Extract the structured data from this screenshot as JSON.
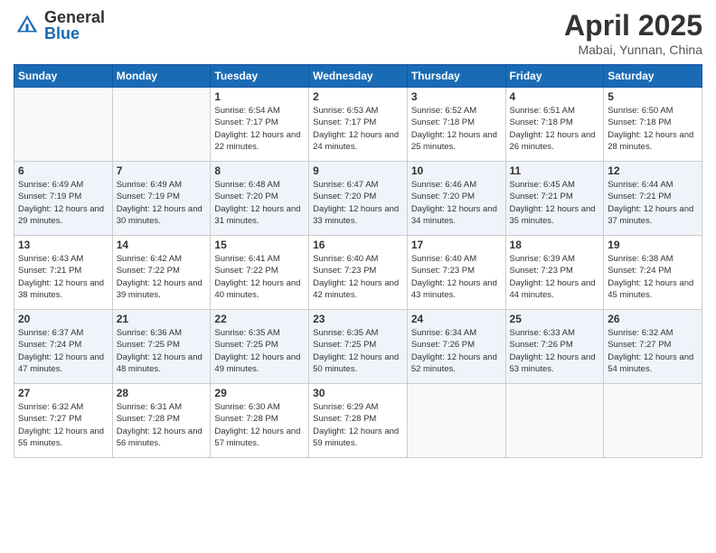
{
  "header": {
    "logo_general": "General",
    "logo_blue": "Blue",
    "title": "April 2025",
    "location": "Mabai, Yunnan, China"
  },
  "weekdays": [
    "Sunday",
    "Monday",
    "Tuesday",
    "Wednesday",
    "Thursday",
    "Friday",
    "Saturday"
  ],
  "weeks": [
    [
      {
        "day": "",
        "sunrise": "",
        "sunset": "",
        "daylight": ""
      },
      {
        "day": "",
        "sunrise": "",
        "sunset": "",
        "daylight": ""
      },
      {
        "day": "1",
        "sunrise": "Sunrise: 6:54 AM",
        "sunset": "Sunset: 7:17 PM",
        "daylight": "Daylight: 12 hours and 22 minutes."
      },
      {
        "day": "2",
        "sunrise": "Sunrise: 6:53 AM",
        "sunset": "Sunset: 7:17 PM",
        "daylight": "Daylight: 12 hours and 24 minutes."
      },
      {
        "day": "3",
        "sunrise": "Sunrise: 6:52 AM",
        "sunset": "Sunset: 7:18 PM",
        "daylight": "Daylight: 12 hours and 25 minutes."
      },
      {
        "day": "4",
        "sunrise": "Sunrise: 6:51 AM",
        "sunset": "Sunset: 7:18 PM",
        "daylight": "Daylight: 12 hours and 26 minutes."
      },
      {
        "day": "5",
        "sunrise": "Sunrise: 6:50 AM",
        "sunset": "Sunset: 7:18 PM",
        "daylight": "Daylight: 12 hours and 28 minutes."
      }
    ],
    [
      {
        "day": "6",
        "sunrise": "Sunrise: 6:49 AM",
        "sunset": "Sunset: 7:19 PM",
        "daylight": "Daylight: 12 hours and 29 minutes."
      },
      {
        "day": "7",
        "sunrise": "Sunrise: 6:49 AM",
        "sunset": "Sunset: 7:19 PM",
        "daylight": "Daylight: 12 hours and 30 minutes."
      },
      {
        "day": "8",
        "sunrise": "Sunrise: 6:48 AM",
        "sunset": "Sunset: 7:20 PM",
        "daylight": "Daylight: 12 hours and 31 minutes."
      },
      {
        "day": "9",
        "sunrise": "Sunrise: 6:47 AM",
        "sunset": "Sunset: 7:20 PM",
        "daylight": "Daylight: 12 hours and 33 minutes."
      },
      {
        "day": "10",
        "sunrise": "Sunrise: 6:46 AM",
        "sunset": "Sunset: 7:20 PM",
        "daylight": "Daylight: 12 hours and 34 minutes."
      },
      {
        "day": "11",
        "sunrise": "Sunrise: 6:45 AM",
        "sunset": "Sunset: 7:21 PM",
        "daylight": "Daylight: 12 hours and 35 minutes."
      },
      {
        "day": "12",
        "sunrise": "Sunrise: 6:44 AM",
        "sunset": "Sunset: 7:21 PM",
        "daylight": "Daylight: 12 hours and 37 minutes."
      }
    ],
    [
      {
        "day": "13",
        "sunrise": "Sunrise: 6:43 AM",
        "sunset": "Sunset: 7:21 PM",
        "daylight": "Daylight: 12 hours and 38 minutes."
      },
      {
        "day": "14",
        "sunrise": "Sunrise: 6:42 AM",
        "sunset": "Sunset: 7:22 PM",
        "daylight": "Daylight: 12 hours and 39 minutes."
      },
      {
        "day": "15",
        "sunrise": "Sunrise: 6:41 AM",
        "sunset": "Sunset: 7:22 PM",
        "daylight": "Daylight: 12 hours and 40 minutes."
      },
      {
        "day": "16",
        "sunrise": "Sunrise: 6:40 AM",
        "sunset": "Sunset: 7:23 PM",
        "daylight": "Daylight: 12 hours and 42 minutes."
      },
      {
        "day": "17",
        "sunrise": "Sunrise: 6:40 AM",
        "sunset": "Sunset: 7:23 PM",
        "daylight": "Daylight: 12 hours and 43 minutes."
      },
      {
        "day": "18",
        "sunrise": "Sunrise: 6:39 AM",
        "sunset": "Sunset: 7:23 PM",
        "daylight": "Daylight: 12 hours and 44 minutes."
      },
      {
        "day": "19",
        "sunrise": "Sunrise: 6:38 AM",
        "sunset": "Sunset: 7:24 PM",
        "daylight": "Daylight: 12 hours and 45 minutes."
      }
    ],
    [
      {
        "day": "20",
        "sunrise": "Sunrise: 6:37 AM",
        "sunset": "Sunset: 7:24 PM",
        "daylight": "Daylight: 12 hours and 47 minutes."
      },
      {
        "day": "21",
        "sunrise": "Sunrise: 6:36 AM",
        "sunset": "Sunset: 7:25 PM",
        "daylight": "Daylight: 12 hours and 48 minutes."
      },
      {
        "day": "22",
        "sunrise": "Sunrise: 6:35 AM",
        "sunset": "Sunset: 7:25 PM",
        "daylight": "Daylight: 12 hours and 49 minutes."
      },
      {
        "day": "23",
        "sunrise": "Sunrise: 6:35 AM",
        "sunset": "Sunset: 7:25 PM",
        "daylight": "Daylight: 12 hours and 50 minutes."
      },
      {
        "day": "24",
        "sunrise": "Sunrise: 6:34 AM",
        "sunset": "Sunset: 7:26 PM",
        "daylight": "Daylight: 12 hours and 52 minutes."
      },
      {
        "day": "25",
        "sunrise": "Sunrise: 6:33 AM",
        "sunset": "Sunset: 7:26 PM",
        "daylight": "Daylight: 12 hours and 53 minutes."
      },
      {
        "day": "26",
        "sunrise": "Sunrise: 6:32 AM",
        "sunset": "Sunset: 7:27 PM",
        "daylight": "Daylight: 12 hours and 54 minutes."
      }
    ],
    [
      {
        "day": "27",
        "sunrise": "Sunrise: 6:32 AM",
        "sunset": "Sunset: 7:27 PM",
        "daylight": "Daylight: 12 hours and 55 minutes."
      },
      {
        "day": "28",
        "sunrise": "Sunrise: 6:31 AM",
        "sunset": "Sunset: 7:28 PM",
        "daylight": "Daylight: 12 hours and 56 minutes."
      },
      {
        "day": "29",
        "sunrise": "Sunrise: 6:30 AM",
        "sunset": "Sunset: 7:28 PM",
        "daylight": "Daylight: 12 hours and 57 minutes."
      },
      {
        "day": "30",
        "sunrise": "Sunrise: 6:29 AM",
        "sunset": "Sunset: 7:28 PM",
        "daylight": "Daylight: 12 hours and 59 minutes."
      },
      {
        "day": "",
        "sunrise": "",
        "sunset": "",
        "daylight": ""
      },
      {
        "day": "",
        "sunrise": "",
        "sunset": "",
        "daylight": ""
      },
      {
        "day": "",
        "sunrise": "",
        "sunset": "",
        "daylight": ""
      }
    ]
  ]
}
